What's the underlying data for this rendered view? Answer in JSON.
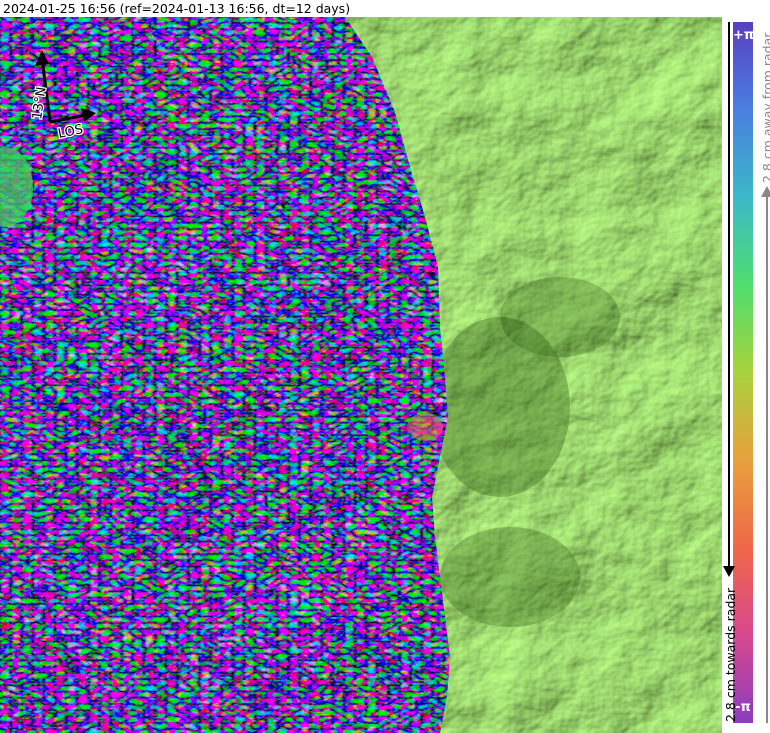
{
  "header": {
    "title": "2024-01-25 16:56 (ref=2024-01-13 16:56, dt=12 days)"
  },
  "compass": {
    "heading_label": "13°N",
    "los_label": "LOS"
  },
  "colorbar": {
    "top_label": "+π",
    "bottom_label": "-π",
    "away_label": "2.8 cm away from radar",
    "towards_label": "2.8 cm towards radar",
    "colors": [
      "#5a3fc0",
      "#4a7fe0",
      "#3cb8c8",
      "#4ede6e",
      "#a8d23c",
      "#e8a03c",
      "#f06848",
      "#d84890",
      "#8a3cc0"
    ]
  },
  "map": {
    "terrain_color": "#55b82c",
    "noisy_region": "wrapped interferogram phase"
  }
}
